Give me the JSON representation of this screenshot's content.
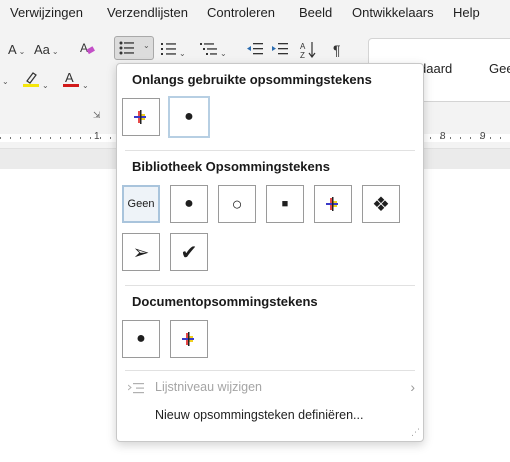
{
  "menubar": {
    "tabs": [
      "Verwijzingen",
      "Verzendlijsten",
      "Controleren",
      "Beeld",
      "Ontwikkelaars",
      "Help"
    ]
  },
  "ribbon": {
    "font_case_label": "Aa",
    "shrink_font_label": "A",
    "font_color_label": "A",
    "paragraph_mark": "¶",
    "style_items": [
      "daard",
      "Gee"
    ],
    "highlight_color": "#f5e60a",
    "font_color": "#d11a1a"
  },
  "ruler": {
    "numbers": [
      "1",
      "8",
      "9"
    ]
  },
  "dropdown": {
    "recent_title": "Onlangs gebruikte opsommingstekens",
    "library_title": "Bibliotheek Opsommingstekens",
    "document_title": "Documentopsommingstekens",
    "none_label": "Geen",
    "bullet_glyphs": {
      "filled_circle": "●",
      "hollow_circle": "○",
      "square": "■",
      "diamond_cluster": "❖",
      "arrowhead": "➢",
      "checkmark": "✔"
    },
    "menu": {
      "change_level_label": "Lijstniveau wijzigen",
      "define_new_label": "Nieuw opsommingsteken definiëren..."
    }
  }
}
